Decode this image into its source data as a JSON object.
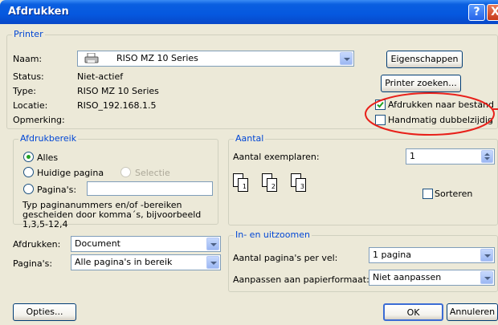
{
  "window": {
    "title": "Afdrukken",
    "help": "?",
    "close": "X"
  },
  "printer": {
    "group_label": "Printer",
    "name_label": "Naam:",
    "name_value": "RISO MZ 10 Series",
    "status_label": "Status:",
    "status_value": "Niet-actief",
    "type_label": "Type:",
    "type_value": "RISO MZ 10 Series",
    "location_label": "Locatie:",
    "location_value": "RISO_192.168.1.5",
    "comment_label": "Opmerking:",
    "properties_button": "Eigenschappen",
    "find_button": "Printer zoeken...",
    "print_to_file_label": "Afdrukken naar bestand",
    "print_to_file_checked": true,
    "manual_duplex_label": "Handmatig dubbelzijdig",
    "manual_duplex_checked": false
  },
  "range": {
    "group_label": "Afdrukbereik",
    "all_label": "Alles",
    "current_label": "Huidige pagina",
    "selection_label": "Selectie",
    "pages_label": "Pagina's:",
    "pages_value": "",
    "hint": "Typ paginanummers en/of -bereiken gescheiden door komma´s, bijvoorbeeld 1,3,5-12,4",
    "selected": "all"
  },
  "copies": {
    "group_label": "Aantal",
    "count_label": "Aantal exemplaren:",
    "count_value": "1",
    "collate_label": "Sorteren",
    "collate_checked": false,
    "page_numbers": [
      "1",
      "2",
      "3"
    ]
  },
  "zoom": {
    "group_label": "In- en uitzoomen",
    "per_sheet_label": "Aantal pagina's per vel:",
    "per_sheet_value": "1 pagina",
    "scale_label": "Aanpassen aan papierformaat:",
    "scale_value": "Niet aanpassen"
  },
  "what": {
    "print_label": "Afdrukken:",
    "print_value": "Document",
    "pages_label": "Pagina's:",
    "pages_value": "Alle pagina's in bereik"
  },
  "footer": {
    "options": "Opties...",
    "ok": "OK",
    "cancel": "Annuleren"
  },
  "colors": {
    "titlebar": "#0558df",
    "group_label": "#0046d5",
    "annotation": "#e8201a",
    "face": "#ece9d8"
  }
}
